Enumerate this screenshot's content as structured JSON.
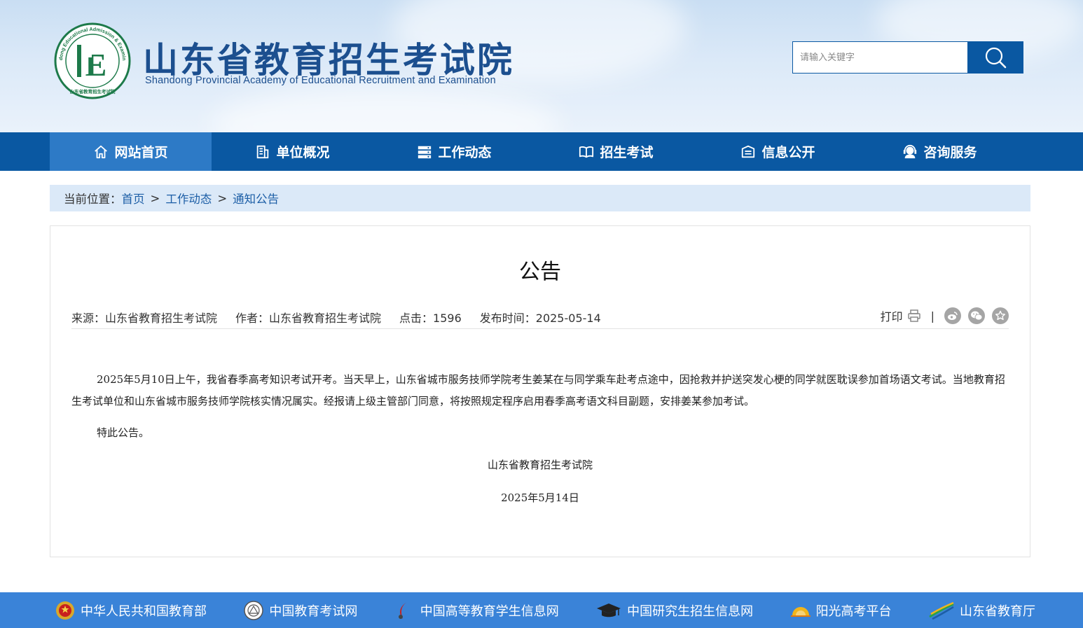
{
  "header": {
    "title_cn": "山东省教育招生考试院",
    "title_en": "Shandong Provincial Academy of Educational Recruitment and Examination",
    "emblem_text_top": "Shandong Educational Admission & Examination",
    "emblem_text_bottom": "山东省教育招生考试院",
    "emblem_letter": "E",
    "search_placeholder": "请输入关键字"
  },
  "nav": {
    "items": [
      {
        "label": "网站首页",
        "icon": "home-icon",
        "active": true
      },
      {
        "label": "单位概况",
        "icon": "building-icon",
        "active": false
      },
      {
        "label": "工作动态",
        "icon": "server-icon",
        "active": false
      },
      {
        "label": "招生考试",
        "icon": "book-icon",
        "active": false
      },
      {
        "label": "信息公开",
        "icon": "folder-icon",
        "active": false
      },
      {
        "label": "咨询服务",
        "icon": "headset-icon",
        "active": false
      }
    ]
  },
  "breadcrumb": {
    "prefix": "当前位置：",
    "items": [
      "首页",
      "工作动态",
      "通知公告"
    ],
    "separator": ">"
  },
  "article": {
    "title": "公告",
    "meta": {
      "source": "来源：山东省教育招生考试院",
      "author": "作者：山东省教育招生考试院",
      "clicks": "点击：1596",
      "date": "发布时间：2025-05-14"
    },
    "tools": {
      "print": "打印",
      "divider": "|"
    },
    "paragraphs": [
      "2025年5月10日上午，我省春季高考知识考试开考。当天早上，山东省城市服务技师学院考生姜某在与同学乘车赴考点途中，因抢救并护送突发心梗的同学就医耽误参加首场语文考试。当地教育招生考试单位和山东省城市服务技师学院核实情况属实。经报请上级主管部门同意，将按照规定程序启用春季高考语文科目副题，安排姜某参加考试。",
      "特此公告。"
    ],
    "signature_org": "山东省教育招生考试院",
    "signature_date": "2025年5月14日"
  },
  "footer": {
    "links": [
      {
        "label": "中华人民共和国教育部",
        "icon": "national-emblem-icon"
      },
      {
        "label": "中国教育考试网",
        "icon": "neea-logo-icon"
      },
      {
        "label": "中国高等教育学生信息网",
        "icon": "chsi-logo-icon"
      },
      {
        "label": "中国研究生招生信息网",
        "icon": "graduation-cap-icon"
      },
      {
        "label": "阳光高考平台",
        "icon": "sunshine-icon"
      },
      {
        "label": "山东省教育厅",
        "icon": "sd-edu-logo-icon"
      }
    ]
  },
  "colors": {
    "primary": "#0a58a2",
    "nav_active": "#2d7ac6",
    "breadcrumb_bg": "#dbe9f8",
    "footer_bg": "#3a83d8",
    "link": "#1c5ea6"
  }
}
